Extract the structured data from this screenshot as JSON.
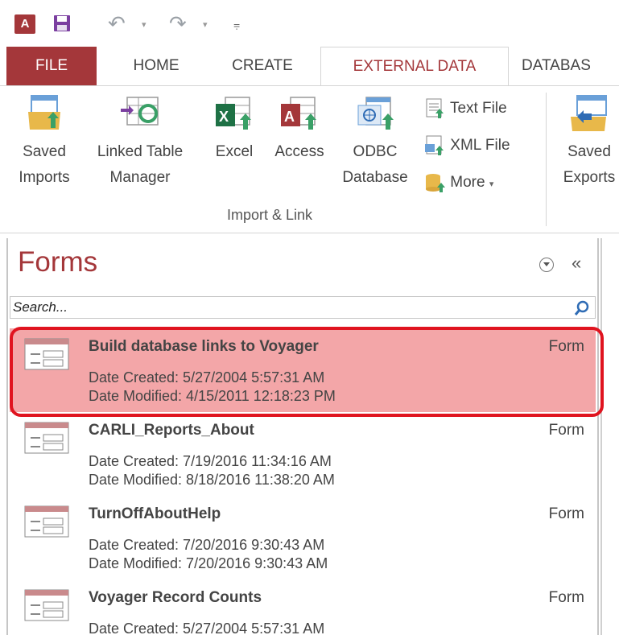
{
  "colors": {
    "accent": "#a4373a",
    "selected_bg": "#f3a6a8",
    "highlight_ring": "#e0141f"
  },
  "qat": {
    "app_icon": "access-logo",
    "app_logo_text": "A",
    "icons": [
      "save-icon",
      "undo-icon",
      "redo-icon",
      "customize-caret-icon"
    ]
  },
  "tabs": [
    {
      "label": "FILE"
    },
    {
      "label": "HOME"
    },
    {
      "label": "CREATE"
    },
    {
      "label": "EXTERNAL DATA",
      "active": true
    },
    {
      "label": "DATABAS"
    }
  ],
  "ribbon": {
    "buttons": {
      "saved_imports": [
        "Saved",
        "Imports"
      ],
      "linked_table_manager": [
        "Linked Table",
        "Manager"
      ],
      "excel": [
        "Excel"
      ],
      "access": [
        "Access"
      ],
      "odbc": [
        "ODBC",
        "Database"
      ],
      "text_file": "Text File",
      "xml_file": "XML File",
      "more": "More",
      "saved_exports": [
        "Saved",
        "Exports"
      ]
    },
    "group_label": "Import & Link"
  },
  "nav_pane": {
    "title": "Forms",
    "search_placeholder": "Search...",
    "items": [
      {
        "name": "Build database links to Voyager",
        "type": "Form",
        "created": "Date Created: 5/27/2004 5:57:31 AM",
        "modified": "Date Modified: 4/15/2011 12:18:23 PM",
        "selected": true
      },
      {
        "name": "CARLI_Reports_About",
        "type": "Form",
        "created": "Date Created: 7/19/2016 11:34:16 AM",
        "modified": "Date Modified: 8/18/2016 11:38:20 AM"
      },
      {
        "name": "TurnOffAboutHelp",
        "type": "Form",
        "created": "Date Created: 7/20/2016 9:30:43 AM",
        "modified": "Date Modified: 7/20/2016 9:30:43 AM"
      },
      {
        "name": "Voyager Record Counts",
        "type": "Form",
        "created": "Date Created: 5/27/2004 5:57:31 AM",
        "modified": ""
      }
    ]
  }
}
